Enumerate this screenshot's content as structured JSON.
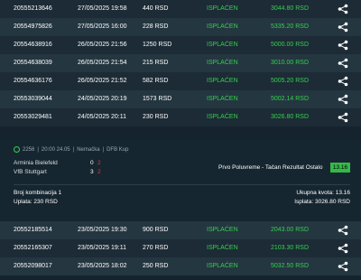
{
  "tickets_top": [
    {
      "id": "20555213646",
      "date": "27/05/2025 19:58",
      "amount": "440 RSD",
      "status": "ISPLAĆEN",
      "win": "3044.80 RSD"
    },
    {
      "id": "20554975826",
      "date": "27/05/2025 16:00",
      "amount": "228 RSD",
      "status": "ISPLAĆEN",
      "win": "5335.20 RSD"
    },
    {
      "id": "20554638916",
      "date": "26/05/2025 21:56",
      "amount": "1250 RSD",
      "status": "ISPLAĆEN",
      "win": "5000.00 RSD"
    },
    {
      "id": "20554638039",
      "date": "26/05/2025 21:54",
      "amount": "215 RSD",
      "status": "ISPLAĆEN",
      "win": "3010.00 RSD"
    },
    {
      "id": "20554636176",
      "date": "26/05/2025 21:52",
      "amount": "582 RSD",
      "status": "ISPLAĆEN",
      "win": "5005.20 RSD"
    },
    {
      "id": "20553039044",
      "date": "24/05/2025 20:19",
      "amount": "1573 RSD",
      "status": "ISPLAĆEN",
      "win": "5002.14 RSD"
    },
    {
      "id": "20553029481",
      "date": "24/05/2025 20:11",
      "amount": "230 RSD",
      "status": "ISPLAĆEN",
      "win": "3026.80 RSD"
    }
  ],
  "detail": {
    "match_id": "2256",
    "time": "20:00 24.05",
    "country": "Nemačka",
    "league": "DFB Kup",
    "home": "Arminia Bielefeld",
    "away": "VfB Stuttgart",
    "home_score": "0",
    "home_score_ht": "2",
    "away_score": "3",
    "away_score_ht": "2",
    "pick": "Prvo Poluvreme - Tačan Rezultat Ostalo",
    "odd": "13.16",
    "combo_label": "Broj kombinacija 1",
    "stake_label": "Uplata: 230 RSD",
    "total_odd_label": "Ukupna kvota: 13.16",
    "payout_label": "Isplata: 3026.80 RSD"
  },
  "tickets_bottom": [
    {
      "id": "20552185514",
      "date": "23/05/2025 19:30",
      "amount": "900 RSD",
      "status": "ISPLAĆEN",
      "win": "2043.00 RSD"
    },
    {
      "id": "20552165307",
      "date": "23/05/2025 19:11",
      "amount": "270 RSD",
      "status": "ISPLAĆEN",
      "win": "2103.30 RSD"
    },
    {
      "id": "20552098017",
      "date": "23/05/2025 18:02",
      "amount": "250 RSD",
      "status": "ISPLAĆEN",
      "win": "5032.50 RSD"
    }
  ],
  "icons": {
    "share": "share-icon",
    "clock": "clock-icon"
  },
  "colors": {
    "accent": "#35d14f",
    "bg": "#14232d",
    "row_dark": "#1c2b35",
    "row_light": "#243640"
  }
}
